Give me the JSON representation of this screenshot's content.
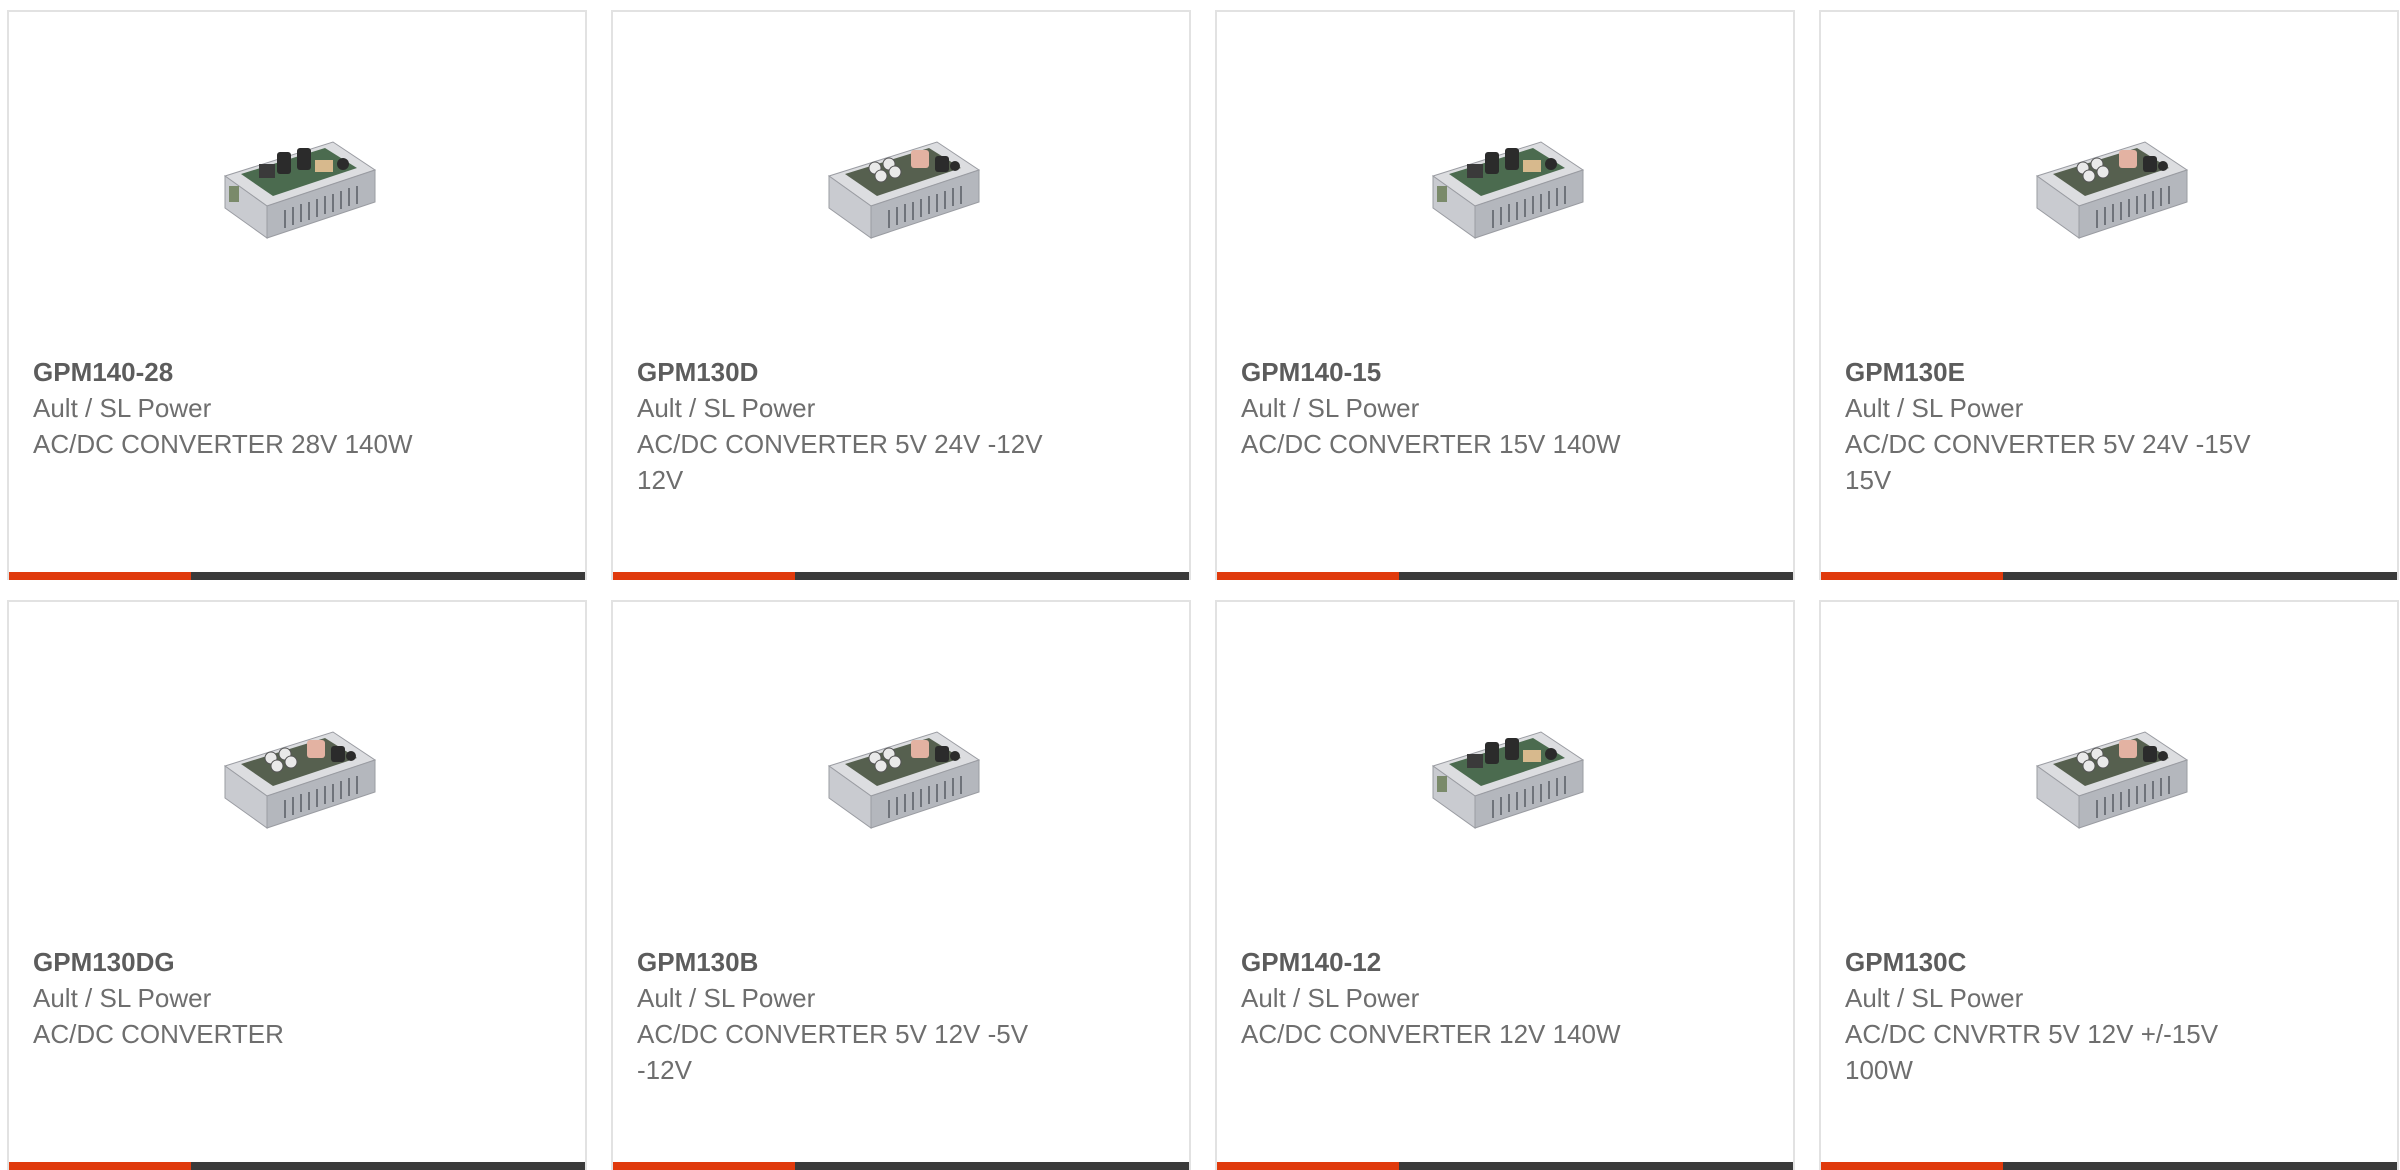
{
  "theme": {
    "accent_color": "#e03a0c",
    "bar_color": "#3a3a3a",
    "text_color": "#6e6e6e"
  },
  "products": [
    {
      "part_number": "GPM140-28",
      "manufacturer": "Ault / SL Power",
      "description": "AC/DC CONVERTER 28V 140W",
      "image_icon": "power-supply-image"
    },
    {
      "part_number": "GPM130D",
      "manufacturer": "Ault / SL Power",
      "description": "AC/DC CONVERTER 5V 24V -12V 12V",
      "image_icon": "power-supply-image"
    },
    {
      "part_number": "GPM140-15",
      "manufacturer": "Ault / SL Power",
      "description": "AC/DC CONVERTER 15V 140W",
      "image_icon": "power-supply-image"
    },
    {
      "part_number": "GPM130E",
      "manufacturer": "Ault / SL Power",
      "description": "AC/DC CONVERTER 5V 24V -15V 15V",
      "image_icon": "power-supply-image"
    },
    {
      "part_number": "GPM130DG",
      "manufacturer": "Ault / SL Power",
      "description": "AC/DC CONVERTER",
      "image_icon": "power-supply-image"
    },
    {
      "part_number": "GPM130B",
      "manufacturer": "Ault / SL Power",
      "description": "AC/DC CONVERTER 5V 12V -5V -12V",
      "image_icon": "power-supply-image"
    },
    {
      "part_number": "GPM140-12",
      "manufacturer": "Ault / SL Power",
      "description": "AC/DC CONVERTER 12V 140W",
      "image_icon": "power-supply-image"
    },
    {
      "part_number": "GPM130C",
      "manufacturer": "Ault / SL Power",
      "description": "AC/DC CNVRTR 5V 12V +/-15V 100W",
      "image_icon": "power-supply-image"
    }
  ]
}
